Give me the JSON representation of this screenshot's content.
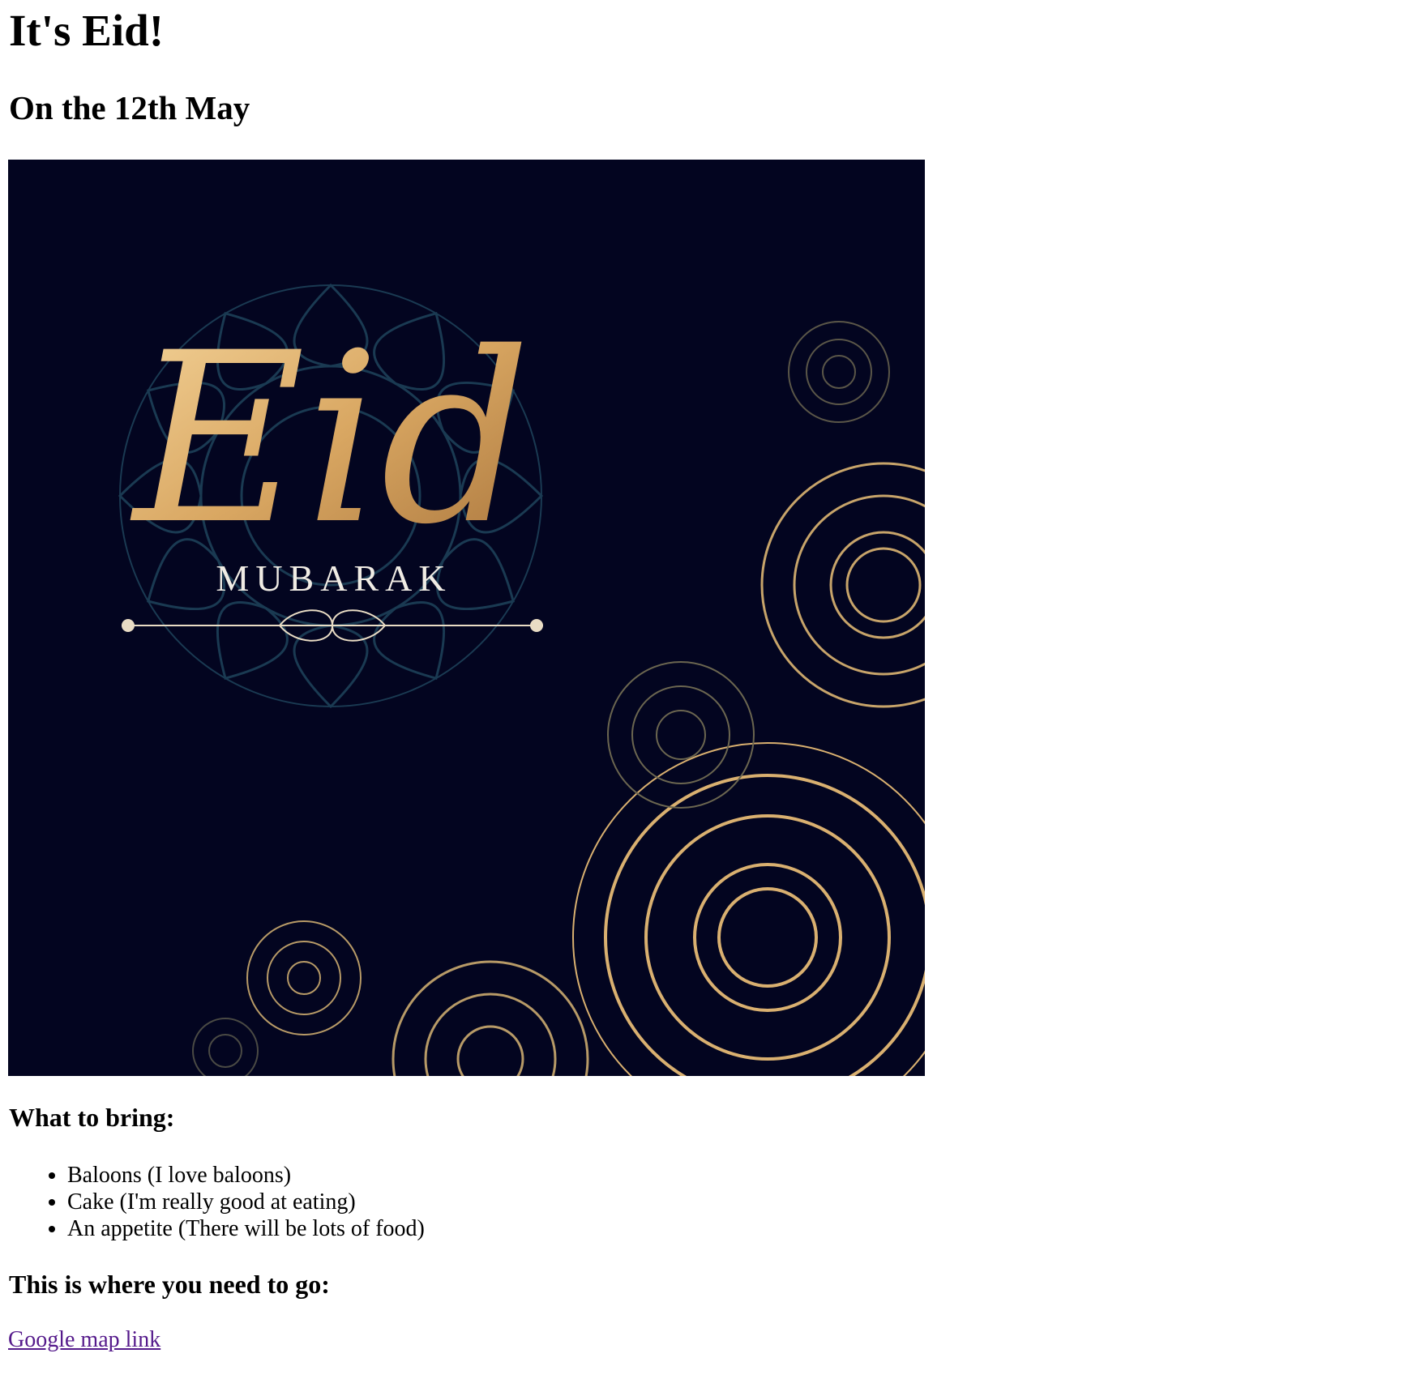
{
  "page": {
    "title": "It's Eid!",
    "date_heading": "On the 12th May"
  },
  "card": {
    "script_text": "Eid",
    "caption": "MUBARAK",
    "colors": {
      "background": "#030520",
      "gold": "#d9b070",
      "teal": "#1a3a52"
    }
  },
  "bring": {
    "heading": "What to bring:",
    "items": [
      "Baloons (I love baloons)",
      "Cake (I'm really good at eating)",
      "An appetite (There will be lots of food)"
    ]
  },
  "directions": {
    "heading": "This is where you need to go:",
    "link_text": "Google map link"
  }
}
